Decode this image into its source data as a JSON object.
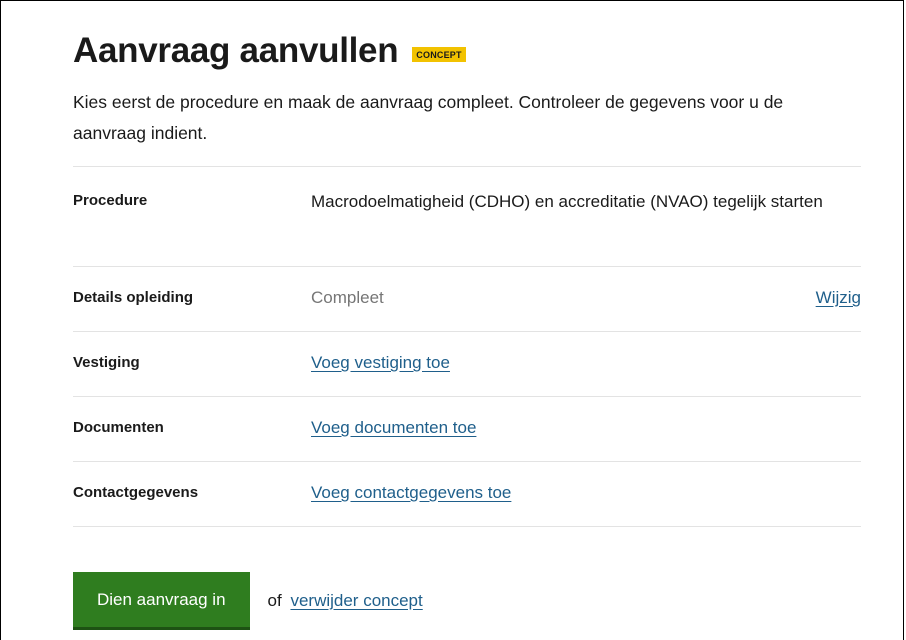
{
  "header": {
    "title": "Aanvraag aanvullen",
    "badge": "CONCEPT",
    "intro": "Kies eerst de procedure en maak de aanvraag compleet. Controleer de gegevens voor u de aanvraag indient."
  },
  "summary": {
    "rows": [
      {
        "label": "Procedure",
        "value": "Macrodoelmatigheid (CDHO) en accreditatie (NVAO) tegelijk starten"
      },
      {
        "label": "Details opleiding",
        "value": "Compleet",
        "action": "Wijzig"
      },
      {
        "label": "Vestiging",
        "link": "Voeg vestiging toe"
      },
      {
        "label": "Documenten",
        "link": "Voeg documenten toe"
      },
      {
        "label": "Contactgegevens",
        "link": "Voeg contactgegevens toe"
      }
    ]
  },
  "actions": {
    "submit_label": "Dien aanvraag in",
    "or_text": "of",
    "delete_label": "verwijder concept"
  },
  "colors": {
    "badge": "#f2c200",
    "primary_button": "#2f7d1f",
    "link": "#1f5f8b"
  }
}
